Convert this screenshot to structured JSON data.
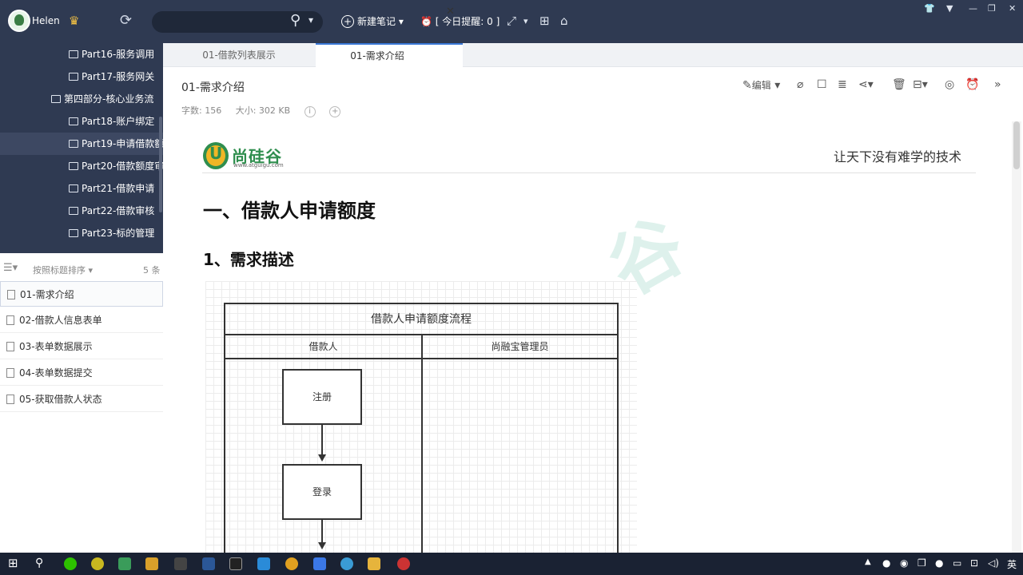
{
  "titlebar": {
    "username": "Helen",
    "new_note": "新建笔记",
    "reminder": "[ 今日提醒: 0 ]"
  },
  "tree": {
    "items": [
      {
        "label": "Part16-服务调用",
        "level": 2
      },
      {
        "label": "Part17-服务网关",
        "level": 2
      },
      {
        "label": "第四部分-核心业务流",
        "level": 1
      },
      {
        "label": "Part18-账户绑定",
        "level": 2
      },
      {
        "label": "Part19-申请借款额",
        "level": 2,
        "selected": true
      },
      {
        "label": "Part20-借款额度审",
        "level": 2
      },
      {
        "label": "Part21-借款申请",
        "level": 2
      },
      {
        "label": "Part22-借款审核",
        "level": 2
      },
      {
        "label": "Part23-标的管理",
        "level": 2
      }
    ]
  },
  "notelist": {
    "sort_label": "按照标题排序",
    "count": "5 条",
    "items": [
      "01-需求介绍",
      "02-借款人信息表单",
      "03-表单数据展示",
      "04-表单数据提交",
      "05-获取借款人状态"
    ]
  },
  "tabs": [
    "01-借款列表展示",
    "01-需求介绍"
  ],
  "document": {
    "title": "01-需求介绍",
    "edit_label": "编辑",
    "word_count": "字数: 156",
    "size": "大小: 302 KB",
    "logo_text": "尚硅谷",
    "logo_url": "www.atguigu.com",
    "slogan": "让天下没有难学的技术",
    "heading1": "一、借款人申请额度",
    "heading2": "1、需求描述"
  },
  "diagram": {
    "title": "借款人申请额度流程",
    "lanes": [
      "借款人",
      "尚融宝管理员"
    ],
    "steps": [
      "注册",
      "登录"
    ]
  },
  "taskbar": {
    "ime": "英"
  },
  "colors": {
    "accent": "#3a78d6",
    "titlebar": "#2f3a52",
    "brand_green": "#2f8e4e",
    "brand_yellow": "#f0b626"
  }
}
